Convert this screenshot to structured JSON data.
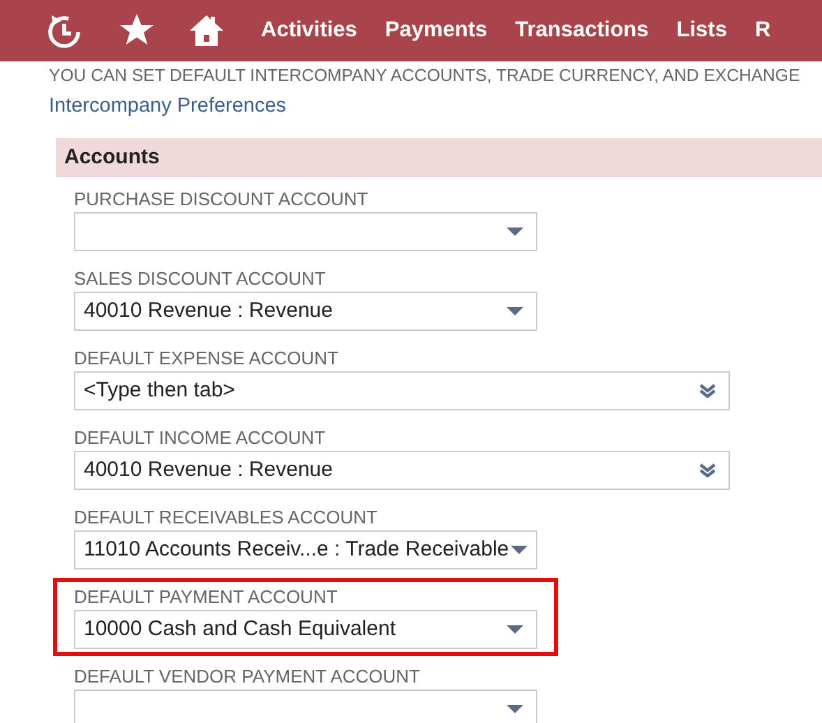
{
  "nav": {
    "items": [
      "Activities",
      "Payments",
      "Transactions",
      "Lists",
      "R"
    ]
  },
  "intro": {
    "text": "YOU CAN SET DEFAULT INTERCOMPANY ACCOUNTS, TRADE CURRENCY, AND EXCHANGE",
    "link": "Intercompany Preferences"
  },
  "section": {
    "title": "Accounts",
    "fields": [
      {
        "label": "PURCHASE DISCOUNT ACCOUNT",
        "kind": "select",
        "highlighted": false
      },
      {
        "label": "SALES DISCOUNT ACCOUNT",
        "kind": "select",
        "value": "40010 Revenue : Revenue",
        "highlighted": false
      },
      {
        "label": "DEFAULT EXPENSE ACCOUNT",
        "kind": "popup",
        "placeholder": "<Type then tab>",
        "highlighted": false
      },
      {
        "label": "DEFAULT INCOME ACCOUNT",
        "kind": "popup",
        "value": "40010 Revenue : Revenue",
        "highlighted": false
      },
      {
        "label": "DEFAULT RECEIVABLES ACCOUNT",
        "kind": "select",
        "value": "11010 Accounts Receiv...e : Trade Receivable",
        "highlighted": false
      },
      {
        "label": "DEFAULT PAYMENT ACCOUNT",
        "kind": "select",
        "value": "10000 Cash and Cash Equivalent",
        "highlighted": true
      },
      {
        "label": "DEFAULT VENDOR PAYMENT ACCOUNT",
        "kind": "select",
        "highlighted": false
      }
    ]
  }
}
